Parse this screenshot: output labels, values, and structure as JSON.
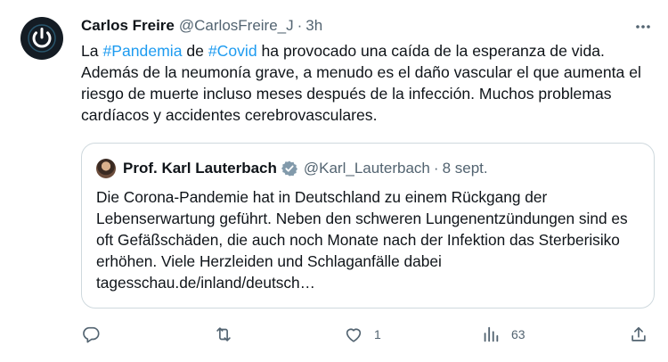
{
  "tweet": {
    "author_name": "Carlos Freire",
    "author_handle": "@CarlosFreire_J",
    "separator": "·",
    "time": "3h",
    "text": {
      "t1": "La ",
      "hashtag1": "#Pandemia",
      "t2": " de ",
      "hashtag2": "#Covid",
      "t3": " ha provocado una caída de la esperanza de vida. Además de la neumonía grave, a menudo es el daño vascular el que aumenta el riesgo de muerte incluso meses después de la infección. Muchos problemas cardíacos y accidentes cerebrovasculares."
    },
    "more_icon": "more-horizontal-icon"
  },
  "quoted": {
    "author_name": "Prof. Karl Lauterbach",
    "verified_icon": "verified-badge-icon",
    "author_handle": "@Karl_Lauterbach",
    "separator": "·",
    "date": "8 sept.",
    "text": "Die Corona-Pandemie hat in Deutschland zu einem Rückgang der Lebenserwartung geführt. Neben den schweren Lungenentzündungen sind es oft Gefäßschäden, die auch noch Monate nach der Infektion das Sterberisiko erhöhen. Viele Herzleiden und Schlaganfälle dabei tagesschau.de/inland/deutsch…"
  },
  "actions": {
    "reply": {
      "icon": "reply-icon",
      "count": ""
    },
    "retweet": {
      "icon": "retweet-icon",
      "count": ""
    },
    "like": {
      "icon": "heart-icon",
      "count": "1"
    },
    "views": {
      "icon": "views-icon",
      "count": "63"
    },
    "share": {
      "icon": "share-icon",
      "count": ""
    }
  },
  "colors": {
    "link": "#1d9bf0",
    "secondary_text": "#536471",
    "border": "#cfd9de",
    "verified": "#829aab"
  }
}
